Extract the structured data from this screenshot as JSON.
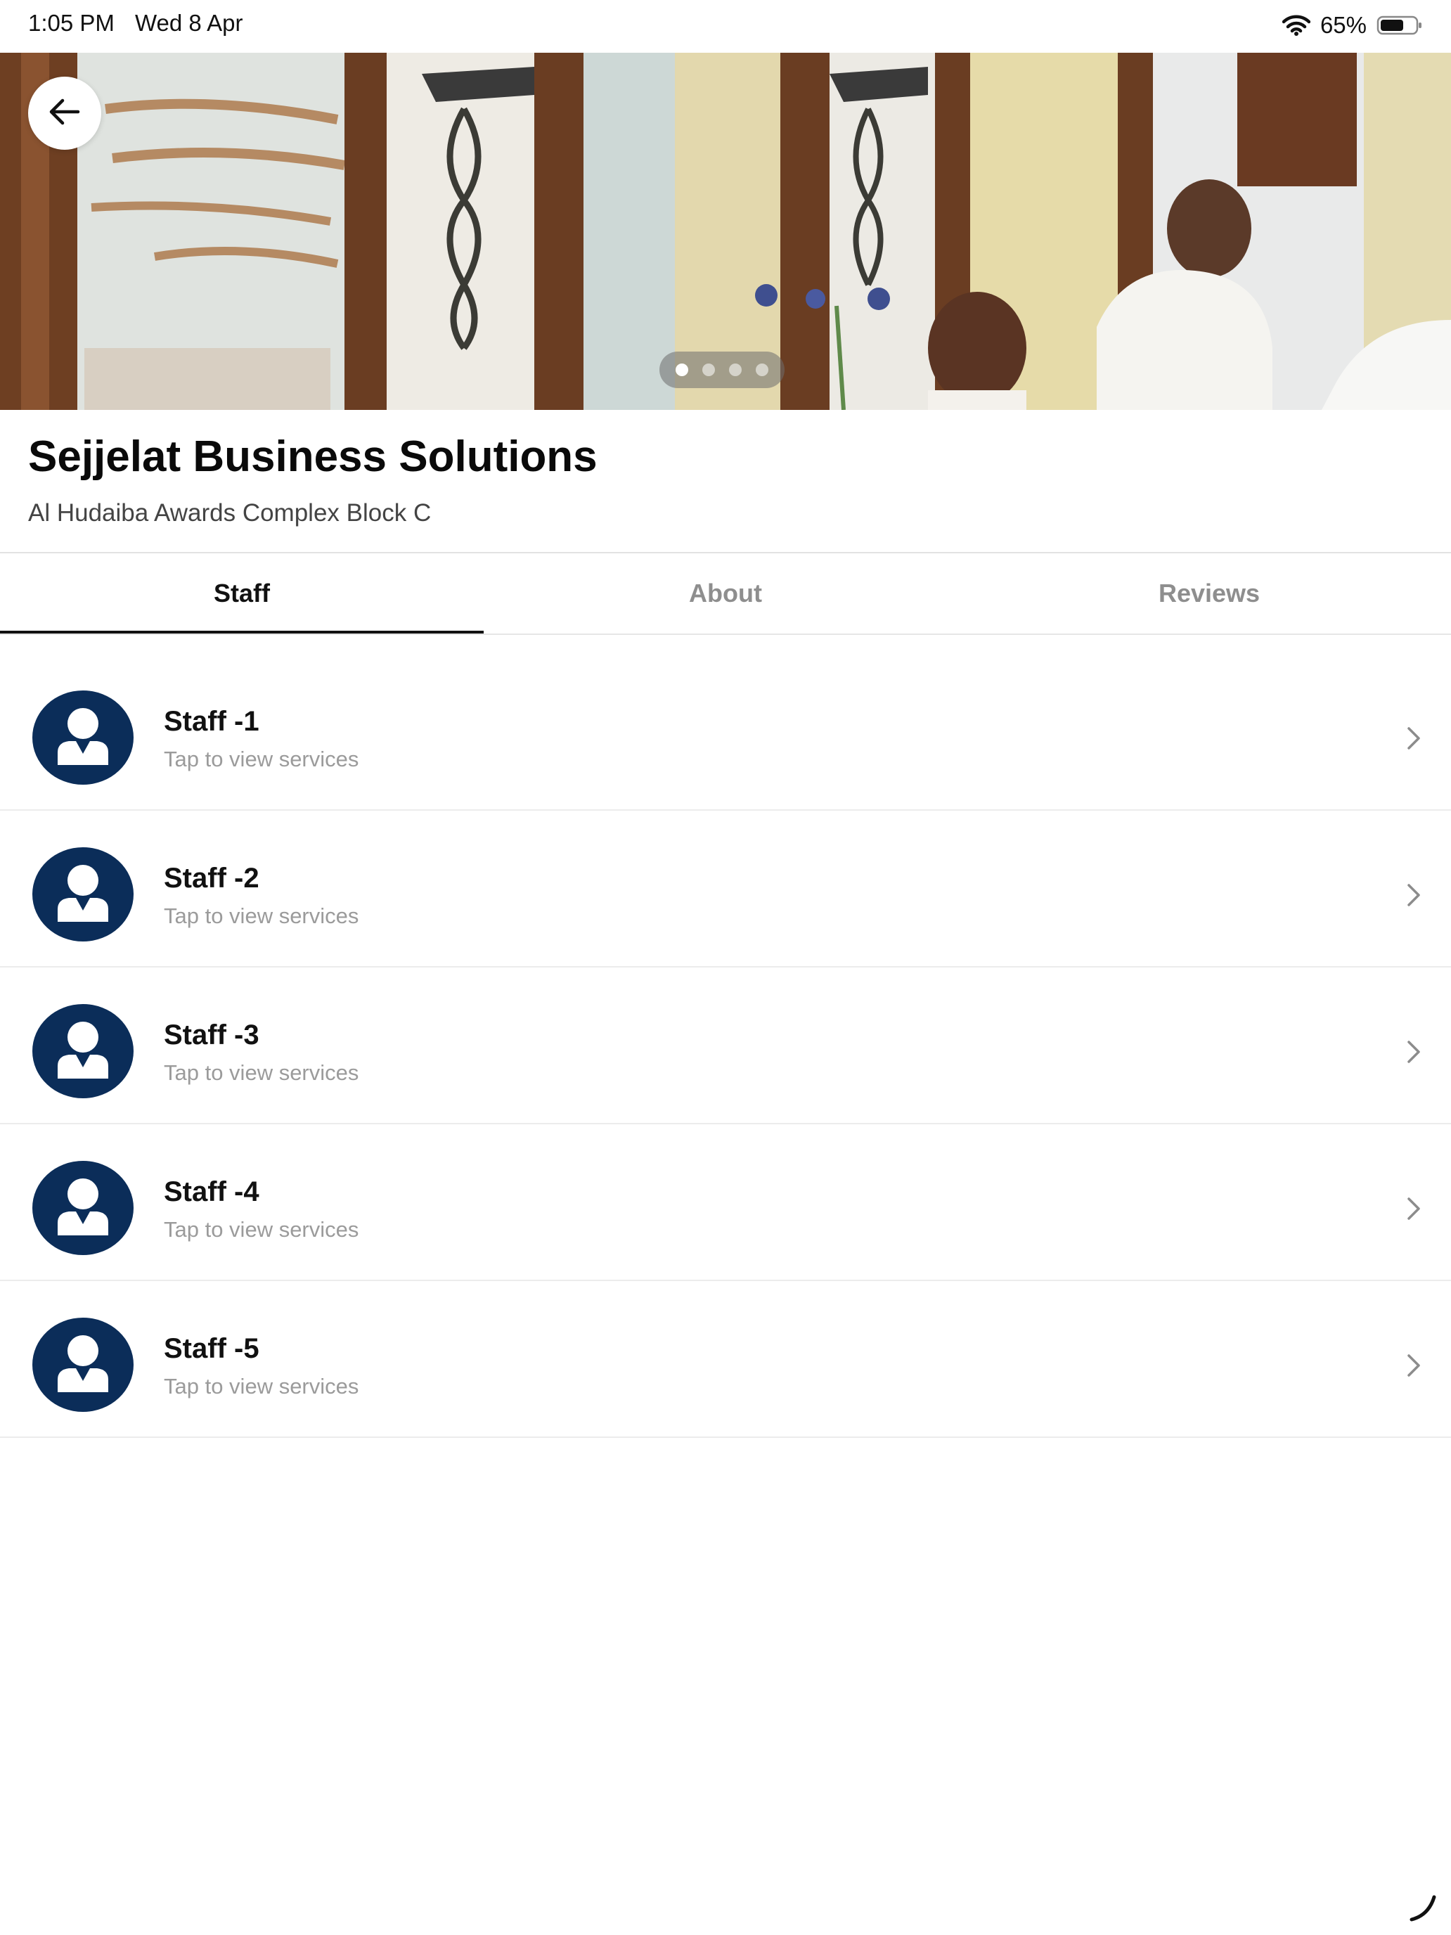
{
  "status_bar": {
    "time": "1:05 PM",
    "date": "Wed 8 Apr",
    "battery_percent": "65%",
    "icons": [
      "wifi-icon",
      "battery-icon"
    ]
  },
  "hero": {
    "page_count": 4,
    "active_page": 1,
    "back_icon": "arrow-left-icon"
  },
  "business": {
    "name": "Sejjelat Business Solutions",
    "address": "Al Hudaiba Awards Complex Block C"
  },
  "tabs": [
    {
      "label": "Staff",
      "active": true
    },
    {
      "label": "About",
      "active": false
    },
    {
      "label": "Reviews",
      "active": false
    }
  ],
  "staff": [
    {
      "name": "Staff -1",
      "subtitle": "Tap to view services"
    },
    {
      "name": "Staff -2",
      "subtitle": "Tap to view services"
    },
    {
      "name": "Staff -3",
      "subtitle": "Tap to view services"
    },
    {
      "name": "Staff -4",
      "subtitle": "Tap to view services"
    },
    {
      "name": "Staff -5",
      "subtitle": "Tap to view services"
    }
  ],
  "colors": {
    "avatar_bg": "#0b2d59",
    "tab_active": "#111111",
    "tab_inactive": "#8e8e8e",
    "subtitle": "#9b9b9b"
  }
}
